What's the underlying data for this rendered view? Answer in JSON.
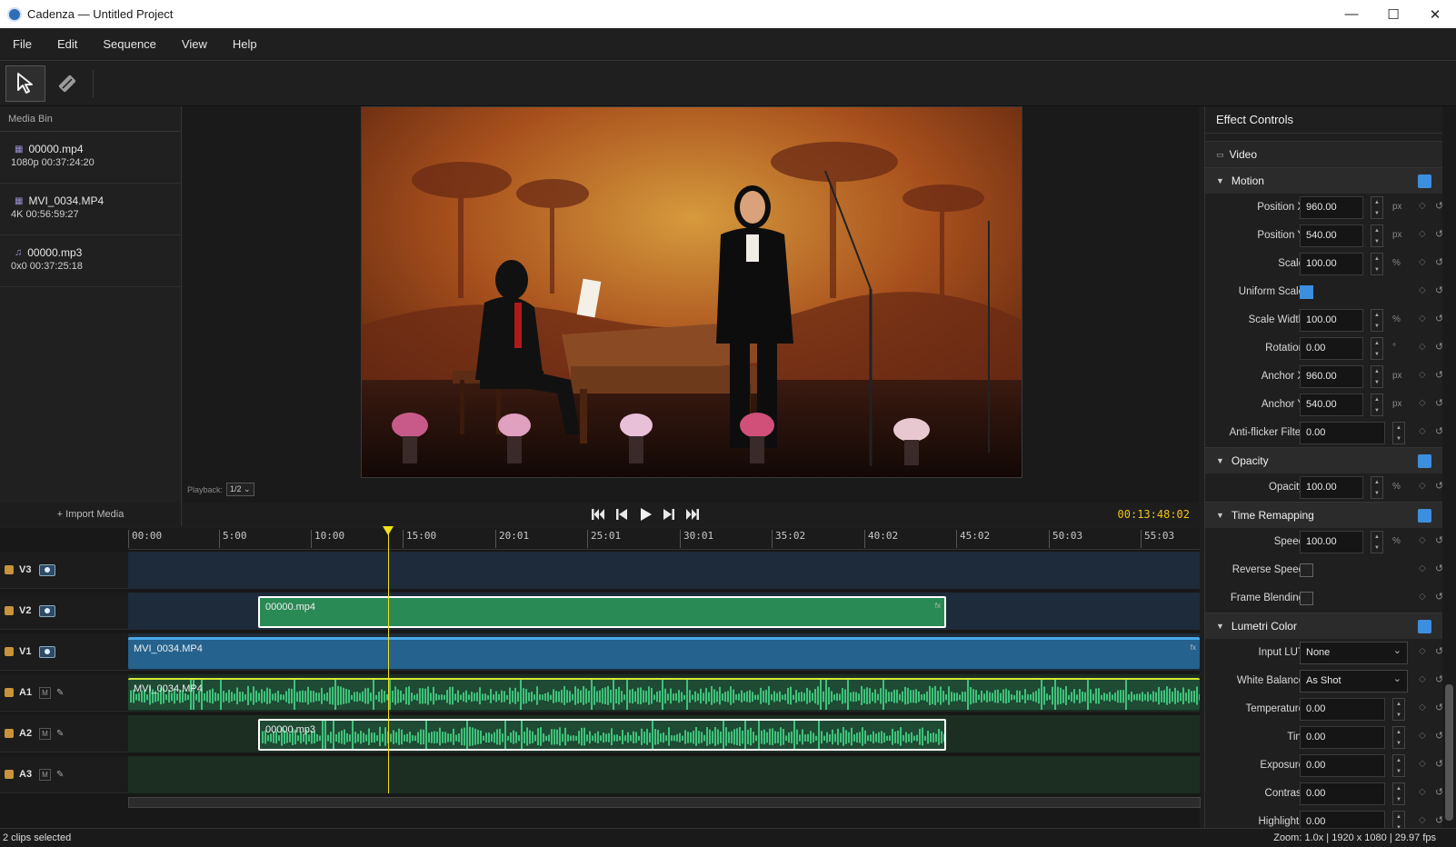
{
  "window": {
    "title": "Cadenza — Untitled Project"
  },
  "menu": [
    "File",
    "Edit",
    "Sequence",
    "View",
    "Help"
  ],
  "mediabin": {
    "header": "Media Bin",
    "items": [
      {
        "name": "00000.mp4",
        "meta": "1080p  00:37:24:20",
        "type": "video"
      },
      {
        "name": "MVI_0034.MP4",
        "meta": "4K  00:56:59:27",
        "type": "video"
      },
      {
        "name": "00000.mp3",
        "meta": "0x0  00:37:25:18",
        "type": "audio"
      }
    ],
    "import_label": "+ Import Media"
  },
  "viewer": {
    "playback_label": "Playback:",
    "playback_value": "1/2",
    "timecode": "00:13:48:02"
  },
  "timeline": {
    "ruler": [
      "00:00",
      "5:00",
      "10:00",
      "15:00",
      "20:01",
      "25:01",
      "30:01",
      "35:02",
      "40:02",
      "45:02",
      "50:03",
      "55:03"
    ],
    "tracks": [
      {
        "name": "V3",
        "kind": "video"
      },
      {
        "name": "V2",
        "kind": "video"
      },
      {
        "name": "V1",
        "kind": "video"
      },
      {
        "name": "A1",
        "kind": "audio"
      },
      {
        "name": "A2",
        "kind": "audio"
      },
      {
        "name": "A3",
        "kind": "audio"
      }
    ],
    "clips": {
      "v2": "00000.mp4",
      "v1": "MVI_0034.MP4",
      "a1": "MVI_0034.MP4",
      "a2": "00000.mp3",
      "fx": "fx"
    },
    "mute_label": "M"
  },
  "effects": {
    "header": "Effect Controls",
    "video_label": "Video",
    "motion": {
      "title": "Motion",
      "rows": [
        {
          "label": "Position X",
          "value": "960.00",
          "unit": "px"
        },
        {
          "label": "Position Y",
          "value": "540.00",
          "unit": "px"
        },
        {
          "label": "Scale",
          "value": "100.00",
          "unit": "%"
        },
        {
          "label": "Uniform Scale",
          "check": true
        },
        {
          "label": "Scale Width",
          "value": "100.00",
          "unit": "%"
        },
        {
          "label": "Rotation",
          "value": "0.00",
          "unit": "°"
        },
        {
          "label": "Anchor X",
          "value": "960.00",
          "unit": "px"
        },
        {
          "label": "Anchor Y",
          "value": "540.00",
          "unit": "px"
        },
        {
          "label": "Anti-flicker Filter",
          "value": "0.00",
          "unit": ""
        }
      ]
    },
    "opacity": {
      "title": "Opacity",
      "rows": [
        {
          "label": "Opacity",
          "value": "100.00",
          "unit": "%"
        }
      ]
    },
    "time": {
      "title": "Time Remapping",
      "rows": [
        {
          "label": "Speed",
          "value": "100.00",
          "unit": "%"
        },
        {
          "label": "Reverse Speed",
          "check": false
        },
        {
          "label": "Frame Blending",
          "check": false
        }
      ]
    },
    "lumetri": {
      "title": "Lumetri Color",
      "rows": [
        {
          "label": "Input LUT",
          "dropdown": "None"
        },
        {
          "label": "White Balance",
          "dropdown": "As Shot"
        },
        {
          "label": "Temperature",
          "value": "0.00"
        },
        {
          "label": "Tint",
          "value": "0.00"
        },
        {
          "label": "Exposure",
          "value": "0.00"
        },
        {
          "label": "Contrast",
          "value": "0.00"
        },
        {
          "label": "Highlights",
          "value": "0.00"
        }
      ]
    }
  },
  "status": {
    "left": "2 clips selected",
    "right": "Zoom: 1.0x  |  1920 x 1080  |  29.97 fps"
  },
  "colors": {
    "accent": "#3c8fde",
    "playhead": "#f0e020",
    "timecode": "#f0c419",
    "video_clip": "#2a8a55",
    "v1_clip": "#25628e"
  }
}
